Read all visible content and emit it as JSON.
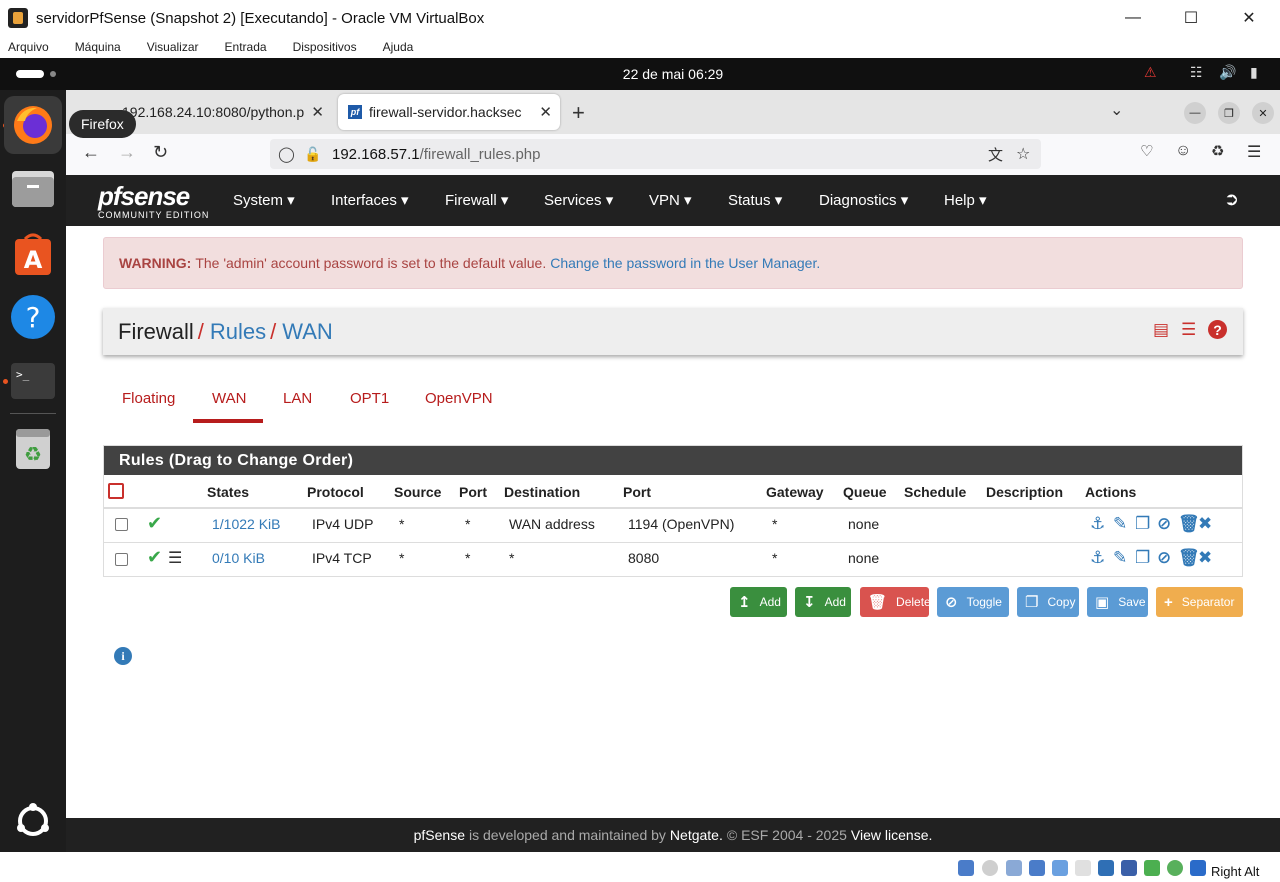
{
  "vbox": {
    "title": "servidorPfSense (Snapshot 2) [Executando] - Oracle VM VirtualBox",
    "menu": [
      "Arquivo",
      "Máquina",
      "Visualizar",
      "Entrada",
      "Dispositivos",
      "Ajuda"
    ],
    "host_key": "Right Alt"
  },
  "ubuntu": {
    "clock": "22 de mai  06:29",
    "tooltip": "Firefox"
  },
  "firefox": {
    "tabs": [
      {
        "label": "192.168.24.10:8080/python.p"
      },
      {
        "label": "firewall-servidor.hacksec"
      }
    ],
    "url_host": "192.168.57.1",
    "url_path": "/firewall_rules.php"
  },
  "pfsense": {
    "logo_main": "pfsense",
    "logo_sub": "COMMUNITY EDITION",
    "menu": [
      "System",
      "Interfaces",
      "Firewall",
      "Services",
      "VPN",
      "Status",
      "Diagnostics",
      "Help"
    ],
    "warning": {
      "label": "WARNING:",
      "text": "The 'admin' account password is set to the default value.",
      "link": "Change the password in the User Manager."
    },
    "breadcrumb": {
      "first": "Firewall",
      "second": "Rules",
      "third": "WAN",
      "sep": "/"
    },
    "tabs": [
      "Floating",
      "WAN",
      "LAN",
      "OPT1",
      "OpenVPN"
    ],
    "panel_title": "Rules (Drag to Change Order)",
    "columns": [
      "States",
      "Protocol",
      "Source",
      "Port",
      "Destination",
      "Port",
      "Gateway",
      "Queue",
      "Schedule",
      "Description",
      "Actions"
    ],
    "rows": [
      {
        "states": "1/1022 KiB",
        "protocol": "IPv4 UDP",
        "source": "*",
        "sport": "*",
        "destination": "WAN address",
        "dport": "1194 (OpenVPN)",
        "gateway": "*",
        "queue": "none",
        "schedule": "",
        "description": ""
      },
      {
        "states": "0/10 KiB",
        "protocol": "IPv4 TCP",
        "source": "*",
        "sport": "*",
        "destination": "*",
        "dport": "8080",
        "gateway": "*",
        "queue": "none",
        "schedule": "",
        "description": ""
      }
    ],
    "buttons": {
      "add_top": "Add",
      "add_bottom": "Add",
      "delete": "Delete",
      "toggle": "Toggle",
      "copy": "Copy",
      "save": "Save",
      "separator": "Separator"
    },
    "footer": {
      "brand": "pfSense",
      "text1": "is developed and maintained by",
      "company": "Netgate.",
      "text2": "© ESF 2004 - 2025",
      "license": "View license."
    },
    "colors": {
      "navbar": "#212121",
      "accent_red": "#b71c1c",
      "link_blue": "#337ab7",
      "pass_green": "#39a84a",
      "btn_green": "#3a8f3e",
      "btn_red": "#d9534f",
      "btn_blue": "#5b9bd5",
      "btn_orange": "#f0ad4e"
    }
  }
}
